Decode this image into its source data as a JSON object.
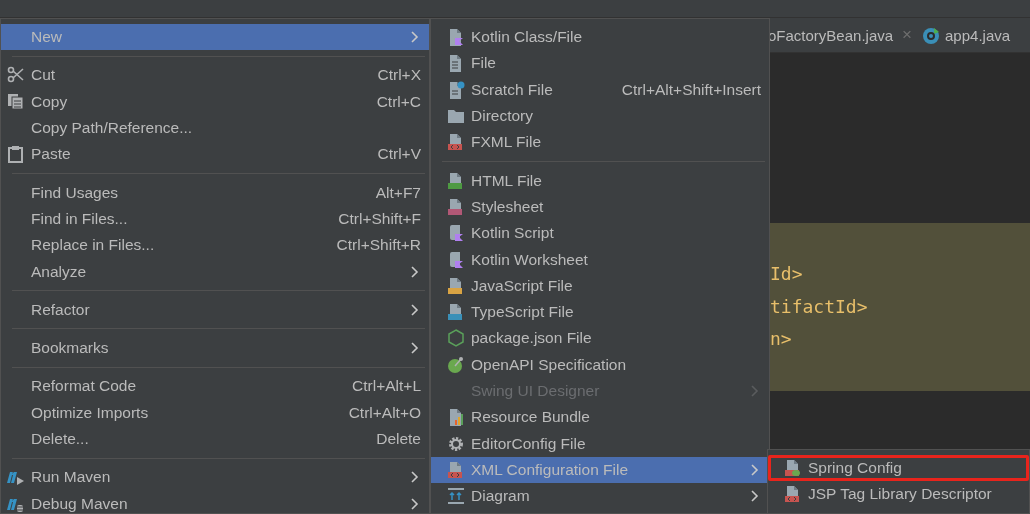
{
  "editor_tabs": [
    {
      "label": "oFactoryBean.java",
      "close": "×"
    },
    {
      "label": "app4.java"
    }
  ],
  "editor": {
    "highlighted_lines": [
      "Id>",
      "tifactId>",
      "n>"
    ]
  },
  "context_menu": [
    {
      "kind": "item",
      "label": "New",
      "submenu": true,
      "selected": true,
      "disabled": false
    },
    {
      "kind": "separator"
    },
    {
      "kind": "item",
      "label": "Cut",
      "shortcut": "Ctrl+X",
      "submenu": false,
      "selected": false,
      "disabled": false
    },
    {
      "kind": "item",
      "label": "Copy",
      "shortcut": "Ctrl+C",
      "submenu": false,
      "selected": false,
      "disabled": false
    },
    {
      "kind": "item",
      "label": "Copy Path/Reference...",
      "submenu": false,
      "selected": false,
      "disabled": false
    },
    {
      "kind": "item",
      "label": "Paste",
      "shortcut": "Ctrl+V",
      "submenu": false,
      "selected": false,
      "disabled": false
    },
    {
      "kind": "separator"
    },
    {
      "kind": "item",
      "label": "Find Usages",
      "shortcut": "Alt+F7",
      "submenu": false,
      "selected": false,
      "disabled": false
    },
    {
      "kind": "item",
      "label": "Find in Files...",
      "shortcut": "Ctrl+Shift+F",
      "submenu": false,
      "selected": false,
      "disabled": false
    },
    {
      "kind": "item",
      "label": "Replace in Files...",
      "shortcut": "Ctrl+Shift+R",
      "submenu": false,
      "selected": false,
      "disabled": false
    },
    {
      "kind": "item",
      "label": "Analyze",
      "submenu": true,
      "selected": false,
      "disabled": false
    },
    {
      "kind": "separator"
    },
    {
      "kind": "item",
      "label": "Refactor",
      "submenu": true,
      "selected": false,
      "disabled": false
    },
    {
      "kind": "separator"
    },
    {
      "kind": "item",
      "label": "Bookmarks",
      "submenu": true,
      "selected": false,
      "disabled": false
    },
    {
      "kind": "separator"
    },
    {
      "kind": "item",
      "label": "Reformat Code",
      "shortcut": "Ctrl+Alt+L",
      "submenu": false,
      "selected": false,
      "disabled": false
    },
    {
      "kind": "item",
      "label": "Optimize Imports",
      "shortcut": "Ctrl+Alt+O",
      "submenu": false,
      "selected": false,
      "disabled": false
    },
    {
      "kind": "item",
      "label": "Delete...",
      "shortcut": "Delete",
      "submenu": false,
      "selected": false,
      "disabled": false
    },
    {
      "kind": "separator"
    },
    {
      "kind": "item",
      "label": "Run Maven",
      "submenu": true,
      "selected": false,
      "disabled": false
    },
    {
      "kind": "item",
      "label": "Debug Maven",
      "submenu": true,
      "selected": false,
      "disabled": false
    }
  ],
  "new_submenu": [
    {
      "kind": "item",
      "label": "Kotlin Class/File",
      "submenu": false,
      "selected": false,
      "disabled": false
    },
    {
      "kind": "item",
      "label": "File",
      "submenu": false,
      "selected": false,
      "disabled": false
    },
    {
      "kind": "item",
      "label": "Scratch File",
      "shortcut": "Ctrl+Alt+Shift+Insert",
      "submenu": false,
      "selected": false,
      "disabled": false
    },
    {
      "kind": "item",
      "label": "Directory",
      "submenu": false,
      "selected": false,
      "disabled": false
    },
    {
      "kind": "item",
      "label": "FXML File",
      "submenu": false,
      "selected": false,
      "disabled": false
    },
    {
      "kind": "separator"
    },
    {
      "kind": "item",
      "label": "HTML File",
      "submenu": false,
      "selected": false,
      "disabled": false
    },
    {
      "kind": "item",
      "label": "Stylesheet",
      "submenu": false,
      "selected": false,
      "disabled": false
    },
    {
      "kind": "item",
      "label": "Kotlin Script",
      "submenu": false,
      "selected": false,
      "disabled": false
    },
    {
      "kind": "item",
      "label": "Kotlin Worksheet",
      "submenu": false,
      "selected": false,
      "disabled": false
    },
    {
      "kind": "item",
      "label": "JavaScript File",
      "submenu": false,
      "selected": false,
      "disabled": false
    },
    {
      "kind": "item",
      "label": "TypeScript File",
      "submenu": false,
      "selected": false,
      "disabled": false
    },
    {
      "kind": "item",
      "label": "package.json File",
      "submenu": false,
      "selected": false,
      "disabled": false
    },
    {
      "kind": "item",
      "label": "OpenAPI Specification",
      "submenu": false,
      "selected": false,
      "disabled": false
    },
    {
      "kind": "item",
      "label": "Swing UI Designer",
      "submenu": true,
      "selected": false,
      "disabled": true
    },
    {
      "kind": "item",
      "label": "Resource Bundle",
      "submenu": false,
      "selected": false,
      "disabled": false
    },
    {
      "kind": "item",
      "label": "EditorConfig File",
      "submenu": false,
      "selected": false,
      "disabled": false
    },
    {
      "kind": "item",
      "label": "XML Configuration File",
      "submenu": true,
      "selected": true,
      "disabled": false
    },
    {
      "kind": "item",
      "label": "Diagram",
      "submenu": true,
      "selected": false,
      "disabled": false
    }
  ],
  "xml_submenu": [
    {
      "kind": "item",
      "label": "Spring Config",
      "submenu": false,
      "selected": false,
      "disabled": false,
      "highlighted": true
    },
    {
      "kind": "item",
      "label": "JSP Tag Library Descriptor",
      "submenu": false,
      "selected": false,
      "disabled": false,
      "highlighted": false
    }
  ]
}
